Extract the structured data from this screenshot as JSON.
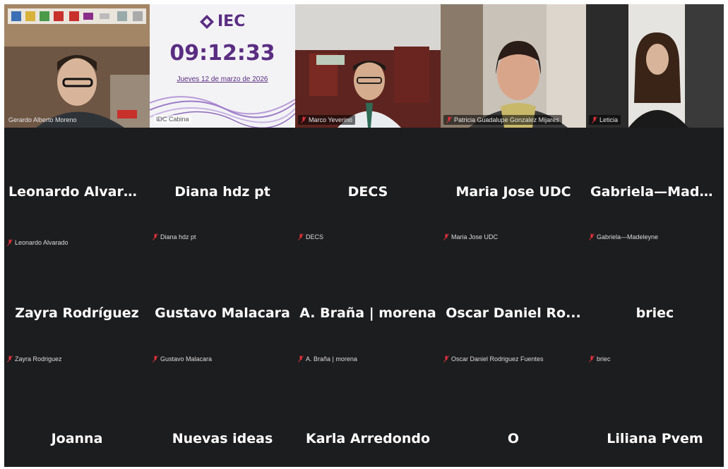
{
  "video_tiles": [
    {
      "label": "Gerardo Alberto Moreno"
    },
    {
      "label": "IDC Cabina",
      "logo": "IEC",
      "time": "09:12:33",
      "date": "Jueves 12 de marzo de 2026"
    },
    {
      "label": "Marco Yeverino"
    },
    {
      "label": "Patricia Guadalupe Gonzalez Mijares"
    },
    {
      "label": "Leticia"
    }
  ],
  "avatar_rows": [
    [
      {
        "display": "Leonardo  Alvara...",
        "label": "Leonardo Alvarado"
      },
      {
        "display": "Diana hdz pt",
        "label": "Diana hdz pt"
      },
      {
        "display": "DECS",
        "label": "DECS"
      },
      {
        "display": "Maria Jose UDC",
        "label": "Maria Jose UDC"
      },
      {
        "display": "Gabriela—Made...",
        "label": "Gabriela—Madeleyne"
      }
    ],
    [
      {
        "display": "Zayra Rodríguez",
        "label": "Zayra Rodriguez"
      },
      {
        "display": "Gustavo Malacara",
        "label": "Gustavo Malacara"
      },
      {
        "display": "A. Braña | morena",
        "label": "A. Braña | morena"
      },
      {
        "display": "Oscar  Daniel  Ro...",
        "label": "Oscar Daniel Rodriguez Fuentes"
      },
      {
        "display": "briec",
        "label": "briec"
      }
    ],
    [
      {
        "display": "Joanna"
      },
      {
        "display": "Nuevas ideas"
      },
      {
        "display": "Karla Arredondo"
      },
      {
        "display": "O"
      },
      {
        "display": "Liliana Pvem"
      }
    ]
  ],
  "colors": {
    "active_speaker": "#3fd36b",
    "muted_mic": "#e0303a",
    "tile_bg": "#1c1d1f",
    "iec_purple": "#5a2d82"
  }
}
